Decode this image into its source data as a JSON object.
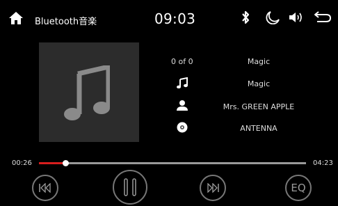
{
  "status_bar": {
    "app_title": "Bluetooth音楽",
    "time": "09:03"
  },
  "track": {
    "counter": "0 of 0",
    "title": "Magic",
    "album": "Magic",
    "artist": "Mrs. GREEN APPLE",
    "source": "ANTENNA"
  },
  "playback": {
    "elapsed": "00:26",
    "total": "04:23",
    "progress": 0.1,
    "state": "playing"
  },
  "controls": {
    "eq_label": "EQ"
  },
  "colors": {
    "background": "#000000",
    "accent": "#d81e1e",
    "album_bg": "#2c2c2c"
  },
  "icons": [
    "home-icon",
    "bluetooth-icon",
    "moon-icon",
    "volume-icon",
    "back-icon",
    "music-note-icon",
    "person-icon",
    "disc-icon",
    "previous-icon",
    "pause-icon",
    "next-icon"
  ]
}
